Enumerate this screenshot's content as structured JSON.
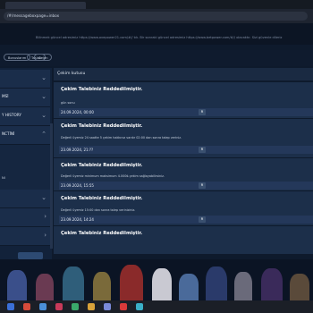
{
  "browser": {
    "url": "/#/messageboxpage=inbox"
  },
  "ticker": "Bilinmek güncel adresimiz https://www.ovepower21.com/#// tık. Bir sonraki güncel adresimiz https://www.betpower.com/#// olacaktır. Sizi güvenle dileriz",
  "chips": [
    "Bonuslarım",
    "Taslak",
    "Gelen"
  ],
  "sidebar": {
    "items": [
      {
        "label": "",
        "chevron": "⌄"
      },
      {
        "label": "MSİ",
        "chevron": "⌄"
      },
      {
        "label": "Y HISTORY",
        "chevron": "⌄"
      },
      {
        "label": "NCTİNİ",
        "chevron": "⌃"
      },
      {
        "label": "",
        "chevron": "⌄"
      },
      {
        "label": "",
        "chevron": "›"
      },
      {
        "label": "",
        "chevron": "›"
      }
    ],
    "sub_label": "NI"
  },
  "main": {
    "heading": "Çekim kutusu",
    "cards": [
      {
        "title": "Çekim Talebiniz Reddedilmiştir.",
        "message": "gün sonu",
        "date": "24.09.2024, 00:00",
        "button": "R"
      },
      {
        "title": "Çekim Talebiniz Reddedilmiştir.",
        "message": "Değerli üyemiz 24 saatte 5 çekim hakkınız vardır 02:00 dan sonra talep veriniz.",
        "date": "23.09.2024, 21:??",
        "button": "R"
      },
      {
        "title": "Çekim Talebiniz Reddedilmiştir.",
        "message": "Değerli üyemiz minimum maksimum 4.000₺ çekim sağlayabilirsiniz.",
        "date": "23.09.2024, 15:55",
        "button": "R"
      },
      {
        "title": "Çekim Talebiniz Reddedilmiştir.",
        "message": "Değerli üyemiz 15:00 dan sonra talep veriniziniz.",
        "date": "23.09.2024, 14:24",
        "button": "R"
      },
      {
        "title": "Çekim Talebiniz Reddedilmiştir.",
        "message": "",
        "date": "",
        "button": "R"
      }
    ]
  },
  "colors": {
    "page_bg": "#0e1a2c",
    "card_bg": "#1c2f4a",
    "date_bar": "#24385a",
    "sidebar_bg": "#12223a"
  }
}
